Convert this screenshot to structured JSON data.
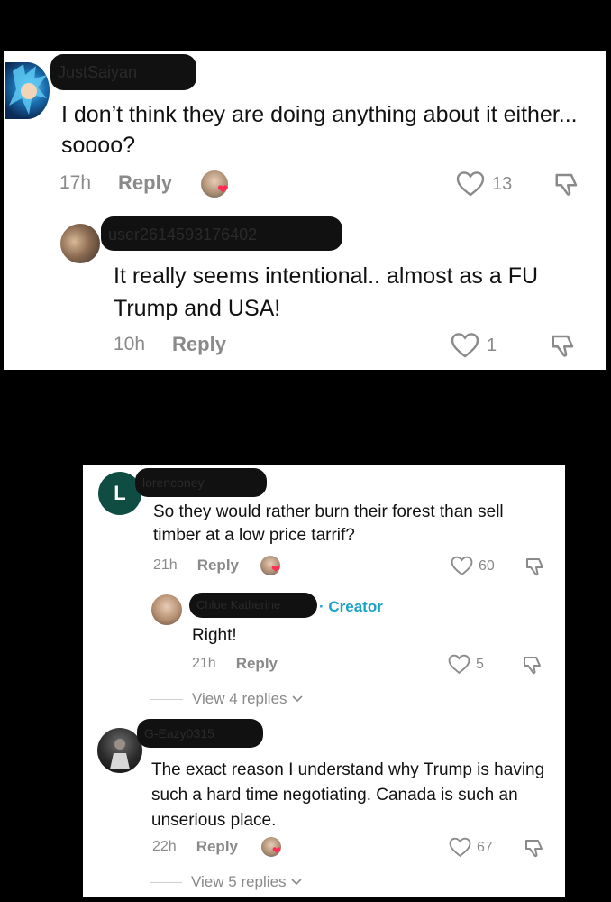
{
  "card1": {
    "comment": {
      "username": "JustSaiyan",
      "text": "I don’t think they are doing anything about it either... soooo?",
      "time": "17h",
      "reply_label": "Reply",
      "likes": "13",
      "creator_liked": true
    },
    "reply": {
      "username": "user2614593176402",
      "text": "It really seems intentional.. almost as a FU Trump and USA!",
      "time": "10h",
      "reply_label": "Reply",
      "likes": "1"
    }
  },
  "card2": {
    "comment1": {
      "username": "lorenconey",
      "avatar_letter": "L",
      "text": "So they would rather burn their forest than sell timber at a low price tarrif?",
      "time": "21h",
      "reply_label": "Reply",
      "likes": "60",
      "creator_liked": true
    },
    "creator_reply": {
      "username": "Chloe Katherine",
      "badge": "· Creator",
      "text": "Right!",
      "time": "21h",
      "reply_label": "Reply",
      "likes": "5",
      "view_replies": "View 4 replies"
    },
    "comment2": {
      "username": "G-Eazy0315",
      "text": "The exact reason I understand why Trump is having such a hard time negotiating. Canada is such an unserious place.",
      "time": "22h",
      "reply_label": "Reply",
      "likes": "67",
      "creator_liked": true,
      "view_replies": "View 5 replies"
    }
  },
  "colors": {
    "creator_badge": "#1aa3c7",
    "heart_badge": "#ff2c55",
    "avatar_l": "#0f4d43"
  }
}
